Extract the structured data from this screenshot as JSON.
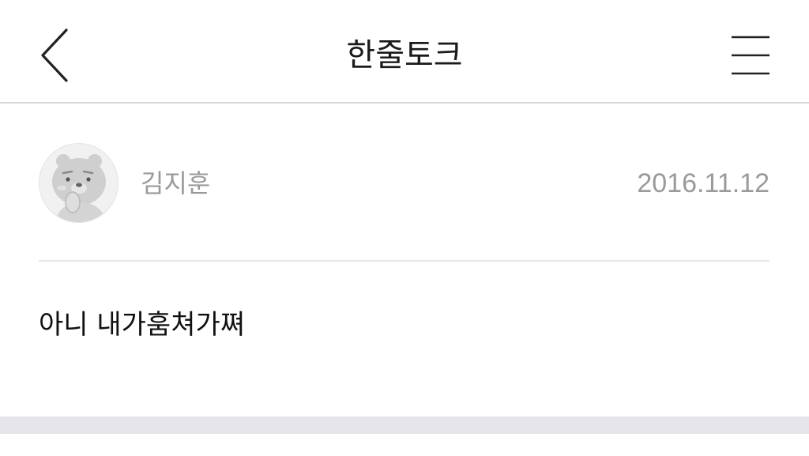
{
  "header": {
    "title": "한줄토크",
    "back_icon": "chevron-left-icon",
    "menu_icon": "hamburger-menu-icon"
  },
  "post": {
    "author": "김지훈",
    "date": "2016.11.12",
    "avatar_icon": "bear-character-avatar",
    "message": "아니 내가훔쳐가쪄"
  },
  "colors": {
    "divider": "#d6d6d6",
    "meta_text": "#9a9a9a",
    "bottom_band": "#e6e5ea"
  }
}
